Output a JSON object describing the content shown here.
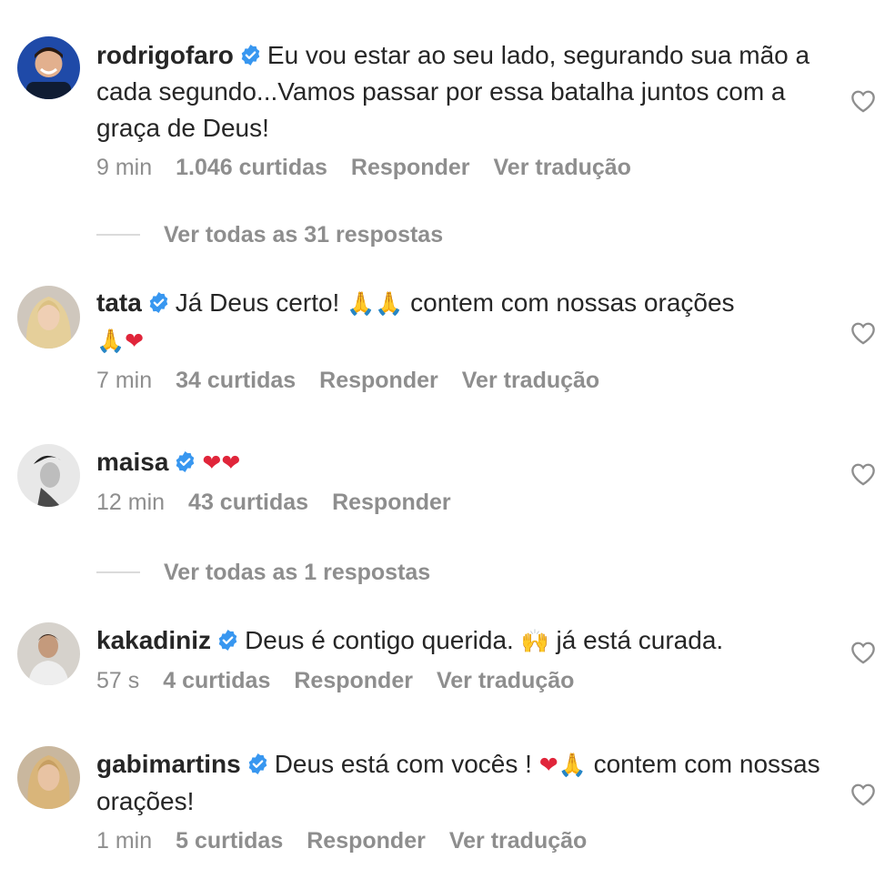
{
  "comments": [
    {
      "username": "rodrigofaro",
      "text": "Eu vou estar ao seu lado, segurando sua mão a cada segundo...Vamos passar por essa batalha juntos com a graça de Deus!",
      "time": "9 min",
      "likes": "1.046 curtidas",
      "reply": "Responder",
      "translate": "Ver tradução"
    },
    {
      "username": "tata",
      "text": "Já Deus certo! ",
      "text_after_emoji": " contem com nossas orações",
      "emoji_hands_1": "🙏🙏",
      "emoji_line2_hands": "🙏",
      "emoji_line2_heart": "❤",
      "time": "7 min",
      "likes": "34 curtidas",
      "reply": "Responder",
      "translate": "Ver tradução"
    },
    {
      "username": "maisa",
      "emoji": "❤❤",
      "time": "12 min",
      "likes": "43 curtidas",
      "reply": "Responder"
    },
    {
      "username": "kakadiniz",
      "text": "Deus é contigo querida. ",
      "emoji": "🙌",
      "text_after_emoji": " já está curada.",
      "time": "57 s",
      "likes": "4 curtidas",
      "reply": "Responder",
      "translate": "Ver tradução"
    },
    {
      "username": "gabimartins",
      "text": "Deus está com vocês ! ",
      "emoji_heart": "❤",
      "emoji_hands": "🙏",
      "text_after_emoji": " contem com nossas orações!",
      "time": "1 min",
      "likes": "5 curtidas",
      "reply": "Responder",
      "translate": "Ver tradução"
    }
  ],
  "view_replies": [
    "Ver todas as 31 respostas",
    "Ver todas as 1 respostas"
  ],
  "colors": {
    "text": "#262626",
    "secondary": "#8e8e8e",
    "verified": "#3897f0",
    "divider": "#dbdbdb"
  },
  "icons": {
    "verified": "verified-badge-icon",
    "like": "heart-outline-icon"
  }
}
